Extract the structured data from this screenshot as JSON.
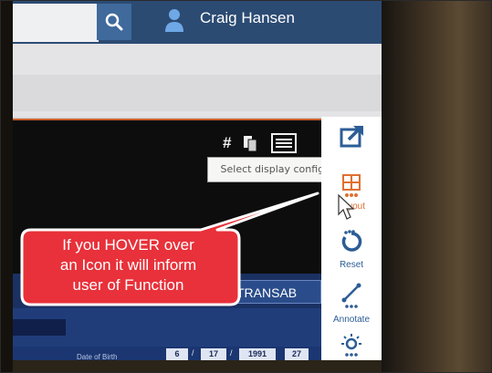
{
  "header": {
    "user_name": "Craig Hansen",
    "search_placeholder": ""
  },
  "viewer": {
    "header_icons": [
      "#",
      "copy-icon",
      "list-icon"
    ],
    "tooltip": "Select display configuration"
  },
  "right_toolbar": {
    "layout_label": "Layout",
    "reset_label": "Reset",
    "annotate_label": "Annotate"
  },
  "lower_panel": {
    "tab_label": "TRANSAB",
    "dob_label": "Date of Birth",
    "dob_month": "6",
    "dob_day": "17",
    "dob_year": "1991",
    "age": "27"
  },
  "callout": {
    "line1": "If you HOVER over",
    "line2": "an Icon it will inform",
    "line3": "user of Function"
  },
  "colors": {
    "topbar": "#2c4b73",
    "toolbar_icon": "#2c5d96",
    "callout_fill": "#e8313a",
    "lower_panel": "#203d7a"
  }
}
